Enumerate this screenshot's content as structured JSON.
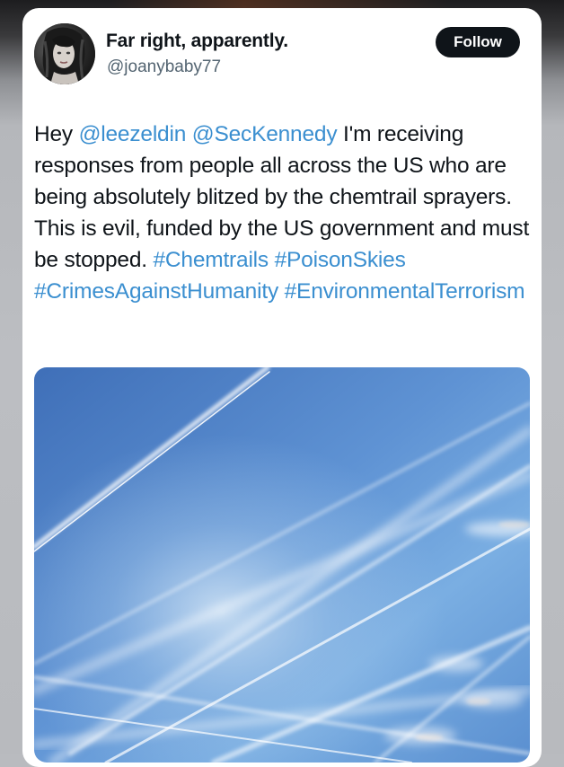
{
  "author": {
    "display_name": "Far right, apparently.",
    "handle": "@joanybaby77"
  },
  "actions": {
    "follow_label": "Follow"
  },
  "tweet": {
    "text_intro": "Hey ",
    "mentions": [
      "@leezeldin",
      "@SecKennedy"
    ],
    "text_body": " I'm receiving responses from people all across the US who are being absolutely blitzed by the chemtrail sprayers. This is evil, funded by the US government and must be stopped. ",
    "hashtags": [
      "#Chemtrails",
      "#PoisonSkies",
      "#CrimesAgainstHumanity",
      "#EnvironmentalTerrorism"
    ]
  },
  "colors": {
    "link": "#3b8fd0",
    "text": "#0f1419",
    "secondary": "#536471",
    "follow_bg": "#0f1419"
  },
  "media": {
    "icon": "photo-icon"
  }
}
